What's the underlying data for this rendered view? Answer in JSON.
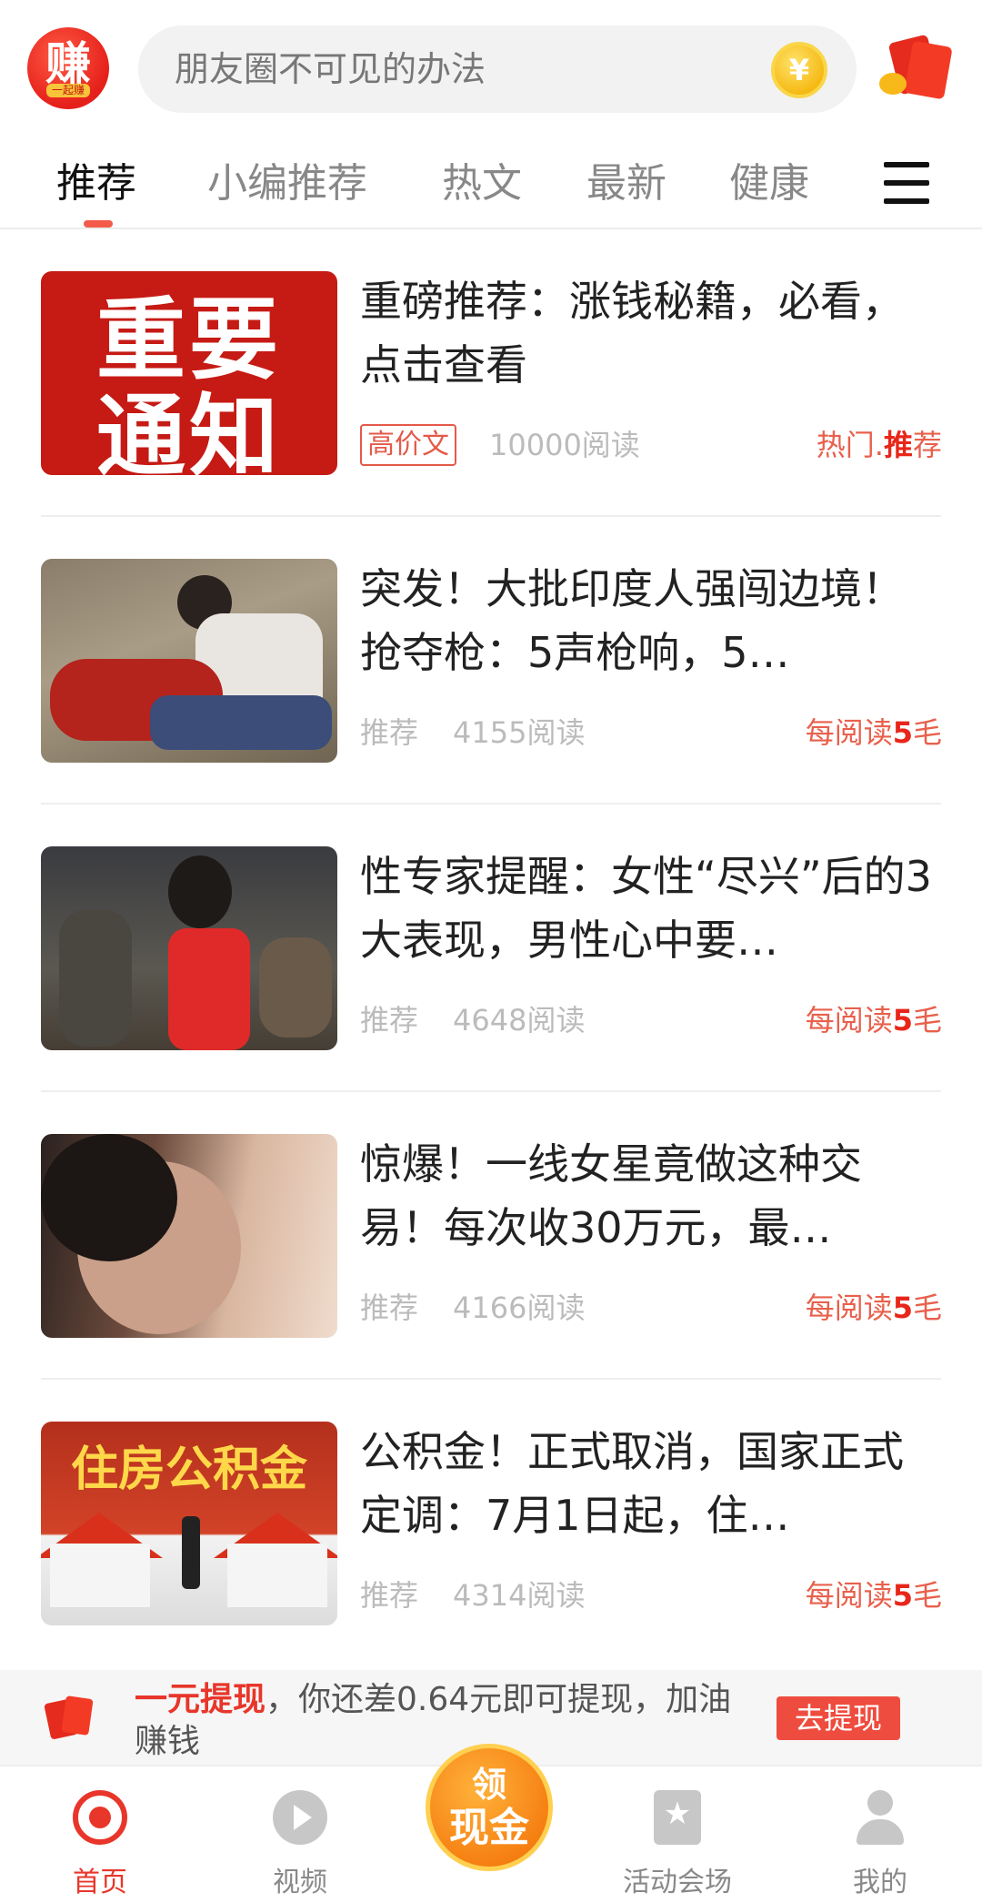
{
  "header": {
    "logo_text": "赚",
    "logo_sub": "一起赚",
    "search_placeholder": "朋友圈不可见的办法",
    "coin_symbol": "¥"
  },
  "tabs": [
    {
      "label": "推荐",
      "active": true
    },
    {
      "label": "小编推荐",
      "active": false
    },
    {
      "label": "热文",
      "active": false
    },
    {
      "label": "最新",
      "active": false
    },
    {
      "label": "健康",
      "active": false
    }
  ],
  "articles": [
    {
      "thumb_text_1": "重要",
      "thumb_text_2": "通知",
      "title": "重磅推荐：涨钱秘籍，必看，点击查看",
      "tag": "高价文",
      "reads": "10000阅读",
      "reward_prefix": "热门.",
      "reward_bold": "推",
      "reward_suffix": "荐"
    },
    {
      "title": "突发！大批印度人强闯边境！抢夺枪：5声枪响，5…",
      "tag": "推荐",
      "reads": "4155阅读",
      "reward_prefix": "每阅读",
      "reward_bold": "5",
      "reward_suffix": "毛"
    },
    {
      "title": "性专家提醒：女性“尽兴”后的3大表现，男性心中要…",
      "tag": "推荐",
      "reads": "4648阅读",
      "reward_prefix": "每阅读",
      "reward_bold": "5",
      "reward_suffix": "毛"
    },
    {
      "title": "惊爆！一线女星竟做这种交易！每次收30万元，最…",
      "tag": "推荐",
      "reads": "4166阅读",
      "reward_prefix": "每阅读",
      "reward_bold": "5",
      "reward_suffix": "毛"
    },
    {
      "thumb_text_1": "住房公积金",
      "title": "公积金！正式取消，国家正式定调：7月1日起，住…",
      "tag": "推荐",
      "reads": "4314阅读",
      "reward_prefix": "每阅读",
      "reward_bold": "5",
      "reward_suffix": "毛"
    }
  ],
  "banner": {
    "highlight": "一元提现",
    "text": "，你还差0.64元即可提现，加油赚钱",
    "button": "去提现"
  },
  "bottom_nav": {
    "items": [
      {
        "label": "首页",
        "icon": "home-icon",
        "active": true
      },
      {
        "label": "视频",
        "icon": "play-icon",
        "active": false
      },
      {
        "label": "活动会场",
        "icon": "star-bookmark-icon",
        "active": false
      },
      {
        "label": "我的",
        "icon": "user-icon",
        "active": false
      }
    ],
    "center_line1": "领",
    "center_line2": "现金"
  },
  "colors": {
    "accent": "#e8362a",
    "reward": "#e8604c",
    "muted": "#bbbbbb"
  }
}
